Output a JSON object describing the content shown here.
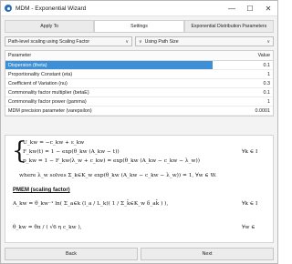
{
  "window": {
    "title": "MDM - Exponential Wizard",
    "controls": {
      "minimize": "—",
      "maximize": "☐",
      "close": "✕"
    }
  },
  "tabs": [
    {
      "label": "Apply To",
      "active": false
    },
    {
      "label": "Settings",
      "active": true
    },
    {
      "label": "Exponential Distribution Parameters",
      "active": false
    }
  ],
  "selects": {
    "scaling": "Path-level scaling using Scaling Factor",
    "path": "Using Path Size"
  },
  "grid": {
    "headers": {
      "parameter": "Parameter",
      "value": "Value"
    },
    "rows": [
      {
        "parameter": "Dispersion (theta)",
        "value": "0.1",
        "selected": true
      },
      {
        "parameter": "Proportionality Constant (eta)",
        "value": "1",
        "selected": false
      },
      {
        "parameter": "Coefficient of Variation (nu)",
        "value": "0.3",
        "selected": false
      },
      {
        "parameter": "Commonality factor multiplier (betaE)",
        "value": "0.1",
        "selected": false
      },
      {
        "parameter": "Commonality factor power (gamma)",
        "value": "1",
        "selected": false
      },
      {
        "parameter": "MDM precision parameter (varepsilon)",
        "value": "0.0001",
        "selected": false
      }
    ]
  },
  "formulas": {
    "line1": "U_kw = −c_kw + ε_kw",
    "line2": "F_kw(t) = 1 − exp(θ_kw (A_kw − t))",
    "line3": "p_kw = 1 − F_kw(λ_w + c_kw) = exp(θ_kw (A_kw − c_kw − λ_w))",
    "forall1": "∀k ∈ I",
    "where": "where λ_w solves Σ_k∈K_w exp(θ_kw (A_kw − c_kw − λ_w)) = 1,  ∀w ∈ W.",
    "pmem": "PMEM (scaling factor)",
    "akw": "A_kw = θ_kw⁻¹ ln( Σ_a∈k (l_a / L_k)( 1 / Σ_k̂∈K_w δ_ak̂ ) ),",
    "forall2": "∀k ∈ I",
    "theta": "θ_kw = θπ / ( √6 η c_kw ),",
    "forall3": "∀w ∈"
  },
  "footer": {
    "back": "Back",
    "next": "Next"
  }
}
